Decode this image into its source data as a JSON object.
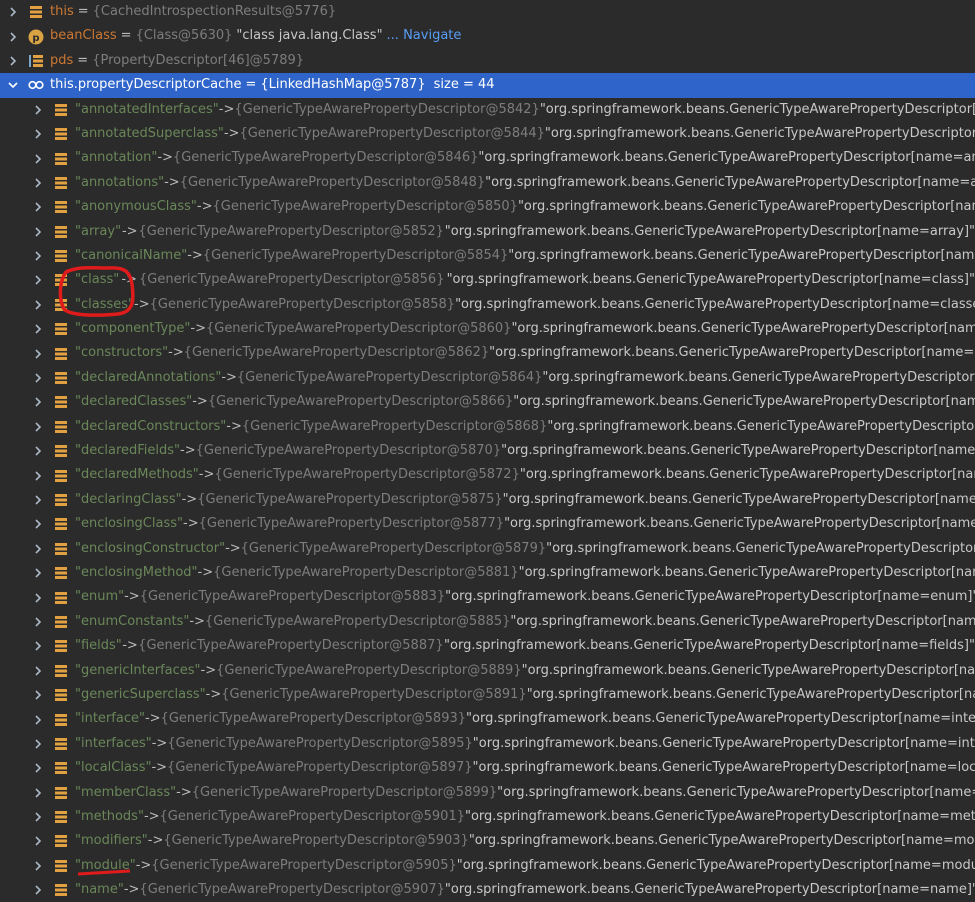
{
  "top_rows": [
    {
      "name": "this",
      "value": "{CachedIntrospectionResults@5776}",
      "icon": "field-icon",
      "kind": "var"
    },
    {
      "name": "beanClass",
      "value": "{Class@5630}",
      "extra": "\"class java.lang.Class\"",
      "nav": "... Navigate",
      "icon": "parameter-icon",
      "kind": "var"
    },
    {
      "name": "pds",
      "value": "{PropertyDescriptor[46]@5789}",
      "icon": "array-icon",
      "kind": "var"
    }
  ],
  "selected_row": {
    "name": "this.propertyDescriptorCache",
    "value": "{LinkedHashMap@5787}",
    "size": "size = 44",
    "icon": "watch-icon"
  },
  "entries": [
    {
      "key": "\"annotatedInterfaces\"",
      "ref": "{GenericTypeAwarePropertyDescriptor@5842}",
      "str": "\"org.springframework.beans.GenericTypeAwarePropertyDescriptor[n"
    },
    {
      "key": "\"annotatedSuperclass\"",
      "ref": "{GenericTypeAwarePropertyDescriptor@5844}",
      "str": "\"org.springframework.beans.GenericTypeAwarePropertyDescriptor[n"
    },
    {
      "key": "\"annotation\"",
      "ref": "{GenericTypeAwarePropertyDescriptor@5846}",
      "str": "\"org.springframework.beans.GenericTypeAwarePropertyDescriptor[name=ann"
    },
    {
      "key": "\"annotations\"",
      "ref": "{GenericTypeAwarePropertyDescriptor@5848}",
      "str": "\"org.springframework.beans.GenericTypeAwarePropertyDescriptor[name=an"
    },
    {
      "key": "\"anonymousClass\"",
      "ref": "{GenericTypeAwarePropertyDescriptor@5850}",
      "str": "\"org.springframework.beans.GenericTypeAwarePropertyDescriptor[nam"
    },
    {
      "key": "\"array\"",
      "ref": "{GenericTypeAwarePropertyDescriptor@5852}",
      "str": "\"org.springframework.beans.GenericTypeAwarePropertyDescriptor[name=array]\""
    },
    {
      "key": "\"canonicalName\"",
      "ref": "{GenericTypeAwarePropertyDescriptor@5854}",
      "str": "\"org.springframework.beans.GenericTypeAwarePropertyDescriptor[name"
    },
    {
      "key": "\"class\"",
      "ref": "{GenericTypeAwarePropertyDescriptor@5856}",
      "str": "\"org.springframework.beans.GenericTypeAwarePropertyDescriptor[name=class]\""
    },
    {
      "key": "\"classes\"",
      "ref": "{GenericTypeAwarePropertyDescriptor@5858}",
      "str": "\"org.springframework.beans.GenericTypeAwarePropertyDescriptor[name=classes]"
    },
    {
      "key": "\"componentType\"",
      "ref": "{GenericTypeAwarePropertyDescriptor@5860}",
      "str": "\"org.springframework.beans.GenericTypeAwarePropertyDescriptor[name"
    },
    {
      "key": "\"constructors\"",
      "ref": "{GenericTypeAwarePropertyDescriptor@5862}",
      "str": "\"org.springframework.beans.GenericTypeAwarePropertyDescriptor[name=co"
    },
    {
      "key": "\"declaredAnnotations\"",
      "ref": "{GenericTypeAwarePropertyDescriptor@5864}",
      "str": "\"org.springframework.beans.GenericTypeAwarePropertyDescriptor[n"
    },
    {
      "key": "\"declaredClasses\"",
      "ref": "{GenericTypeAwarePropertyDescriptor@5866}",
      "str": "\"org.springframework.beans.GenericTypeAwarePropertyDescriptor[name"
    },
    {
      "key": "\"declaredConstructors\"",
      "ref": "{GenericTypeAwarePropertyDescriptor@5868}",
      "str": "\"org.springframework.beans.GenericTypeAwarePropertyDescriptor["
    },
    {
      "key": "\"declaredFields\"",
      "ref": "{GenericTypeAwarePropertyDescriptor@5870}",
      "str": "\"org.springframework.beans.GenericTypeAwarePropertyDescriptor[name="
    },
    {
      "key": "\"declaredMethods\"",
      "ref": "{GenericTypeAwarePropertyDescriptor@5872}",
      "str": "\"org.springframework.beans.GenericTypeAwarePropertyDescriptor[nam"
    },
    {
      "key": "\"declaringClass\"",
      "ref": "{GenericTypeAwarePropertyDescriptor@5875}",
      "str": "\"org.springframework.beans.GenericTypeAwarePropertyDescriptor[name="
    },
    {
      "key": "\"enclosingClass\"",
      "ref": "{GenericTypeAwarePropertyDescriptor@5877}",
      "str": "\"org.springframework.beans.GenericTypeAwarePropertyDescriptor[name="
    },
    {
      "key": "\"enclosingConstructor\"",
      "ref": "{GenericTypeAwarePropertyDescriptor@5879}",
      "str": "\"org.springframework.beans.GenericTypeAwarePropertyDescriptor["
    },
    {
      "key": "\"enclosingMethod\"",
      "ref": "{GenericTypeAwarePropertyDescriptor@5881}",
      "str": "\"org.springframework.beans.GenericTypeAwarePropertyDescriptor[nam"
    },
    {
      "key": "\"enum\"",
      "ref": "{GenericTypeAwarePropertyDescriptor@5883}",
      "str": "\"org.springframework.beans.GenericTypeAwarePropertyDescriptor[name=enum]\""
    },
    {
      "key": "\"enumConstants\"",
      "ref": "{GenericTypeAwarePropertyDescriptor@5885}",
      "str": "\"org.springframework.beans.GenericTypeAwarePropertyDescriptor[name="
    },
    {
      "key": "\"fields\"",
      "ref": "{GenericTypeAwarePropertyDescriptor@5887}",
      "str": "\"org.springframework.beans.GenericTypeAwarePropertyDescriptor[name=fields]\""
    },
    {
      "key": "\"genericInterfaces\"",
      "ref": "{GenericTypeAwarePropertyDescriptor@5889}",
      "str": "\"org.springframework.beans.GenericTypeAwarePropertyDescriptor[nam"
    },
    {
      "key": "\"genericSuperclass\"",
      "ref": "{GenericTypeAwarePropertyDescriptor@5891}",
      "str": "\"org.springframework.beans.GenericTypeAwarePropertyDescriptor[nam"
    },
    {
      "key": "\"interface\"",
      "ref": "{GenericTypeAwarePropertyDescriptor@5893}",
      "str": "\"org.springframework.beans.GenericTypeAwarePropertyDescriptor[name=interf"
    },
    {
      "key": "\"interfaces\"",
      "ref": "{GenericTypeAwarePropertyDescriptor@5895}",
      "str": "\"org.springframework.beans.GenericTypeAwarePropertyDescriptor[name=inter"
    },
    {
      "key": "\"localClass\"",
      "ref": "{GenericTypeAwarePropertyDescriptor@5897}",
      "str": "\"org.springframework.beans.GenericTypeAwarePropertyDescriptor[name=loca"
    },
    {
      "key": "\"memberClass\"",
      "ref": "{GenericTypeAwarePropertyDescriptor@5899}",
      "str": "\"org.springframework.beans.GenericTypeAwarePropertyDescriptor[name=m"
    },
    {
      "key": "\"methods\"",
      "ref": "{GenericTypeAwarePropertyDescriptor@5901}",
      "str": "\"org.springframework.beans.GenericTypeAwarePropertyDescriptor[name=meth"
    },
    {
      "key": "\"modifiers\"",
      "ref": "{GenericTypeAwarePropertyDescriptor@5903}",
      "str": "\"org.springframework.beans.GenericTypeAwarePropertyDescriptor[name=modu"
    },
    {
      "key": "\"module\"",
      "ref": "{GenericTypeAwarePropertyDescriptor@5905}",
      "str": "\"org.springframework.beans.GenericTypeAwarePropertyDescriptor[name=modul"
    },
    {
      "key": "\"name\"",
      "ref": "{GenericTypeAwarePropertyDescriptor@5907}",
      "str": "\"org.springframework.beans.GenericTypeAwarePropertyDescriptor[name=name]\""
    }
  ],
  "arrow_label": "->",
  "equals_label": "=",
  "colors": {
    "background": "#2b2b2b",
    "selection": "#2f65ca",
    "string": "#6a8759",
    "keyword_var": "#cc7832",
    "annotation_red": "#e01b1b"
  }
}
